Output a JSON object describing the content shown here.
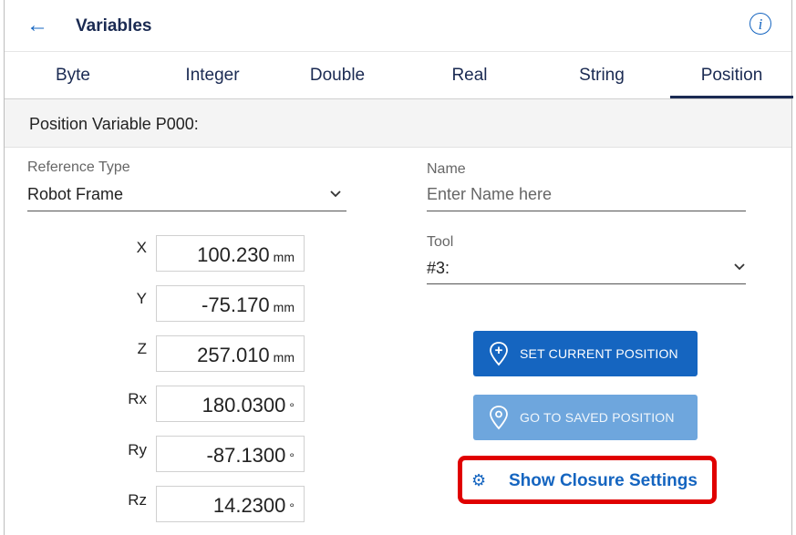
{
  "header": {
    "back_icon": "arrow-left-icon",
    "title": "Variables",
    "info_icon": "info-icon",
    "info_glyph": "i"
  },
  "tabs": [
    {
      "label": "Byte",
      "active": false
    },
    {
      "label": "Integer",
      "active": false
    },
    {
      "label": "Double",
      "active": false
    },
    {
      "label": "Real",
      "active": false
    },
    {
      "label": "String",
      "active": false
    },
    {
      "label": "Position",
      "active": true
    }
  ],
  "section": {
    "title": "Position Variable P000:"
  },
  "reference_type": {
    "label": "Reference Type",
    "value": "Robot Frame"
  },
  "name_field": {
    "label": "Name",
    "placeholder": "Enter Name here"
  },
  "tool": {
    "label": "Tool",
    "value": "#3:"
  },
  "coordinates": [
    {
      "label": "X",
      "value": "100.230",
      "unit": "mm"
    },
    {
      "label": "Y",
      "value": "-75.170",
      "unit": "mm"
    },
    {
      "label": "Z",
      "value": "257.010",
      "unit": "mm"
    },
    {
      "label": "Rx",
      "value": "180.0300",
      "unit": "°"
    },
    {
      "label": "Ry",
      "value": "-87.1300",
      "unit": "°"
    },
    {
      "label": "Rz",
      "value": "14.2300",
      "unit": "°"
    }
  ],
  "buttons": {
    "set_current": "SET CURRENT POSITION",
    "go_to_saved": "GO TO SAVED POSITION",
    "show_closure": "Show Closure Settings"
  },
  "colors": {
    "accent": "#1565c0",
    "disabled": "#6ea6dd",
    "highlight": "#e00000",
    "title": "#1a2a52"
  }
}
